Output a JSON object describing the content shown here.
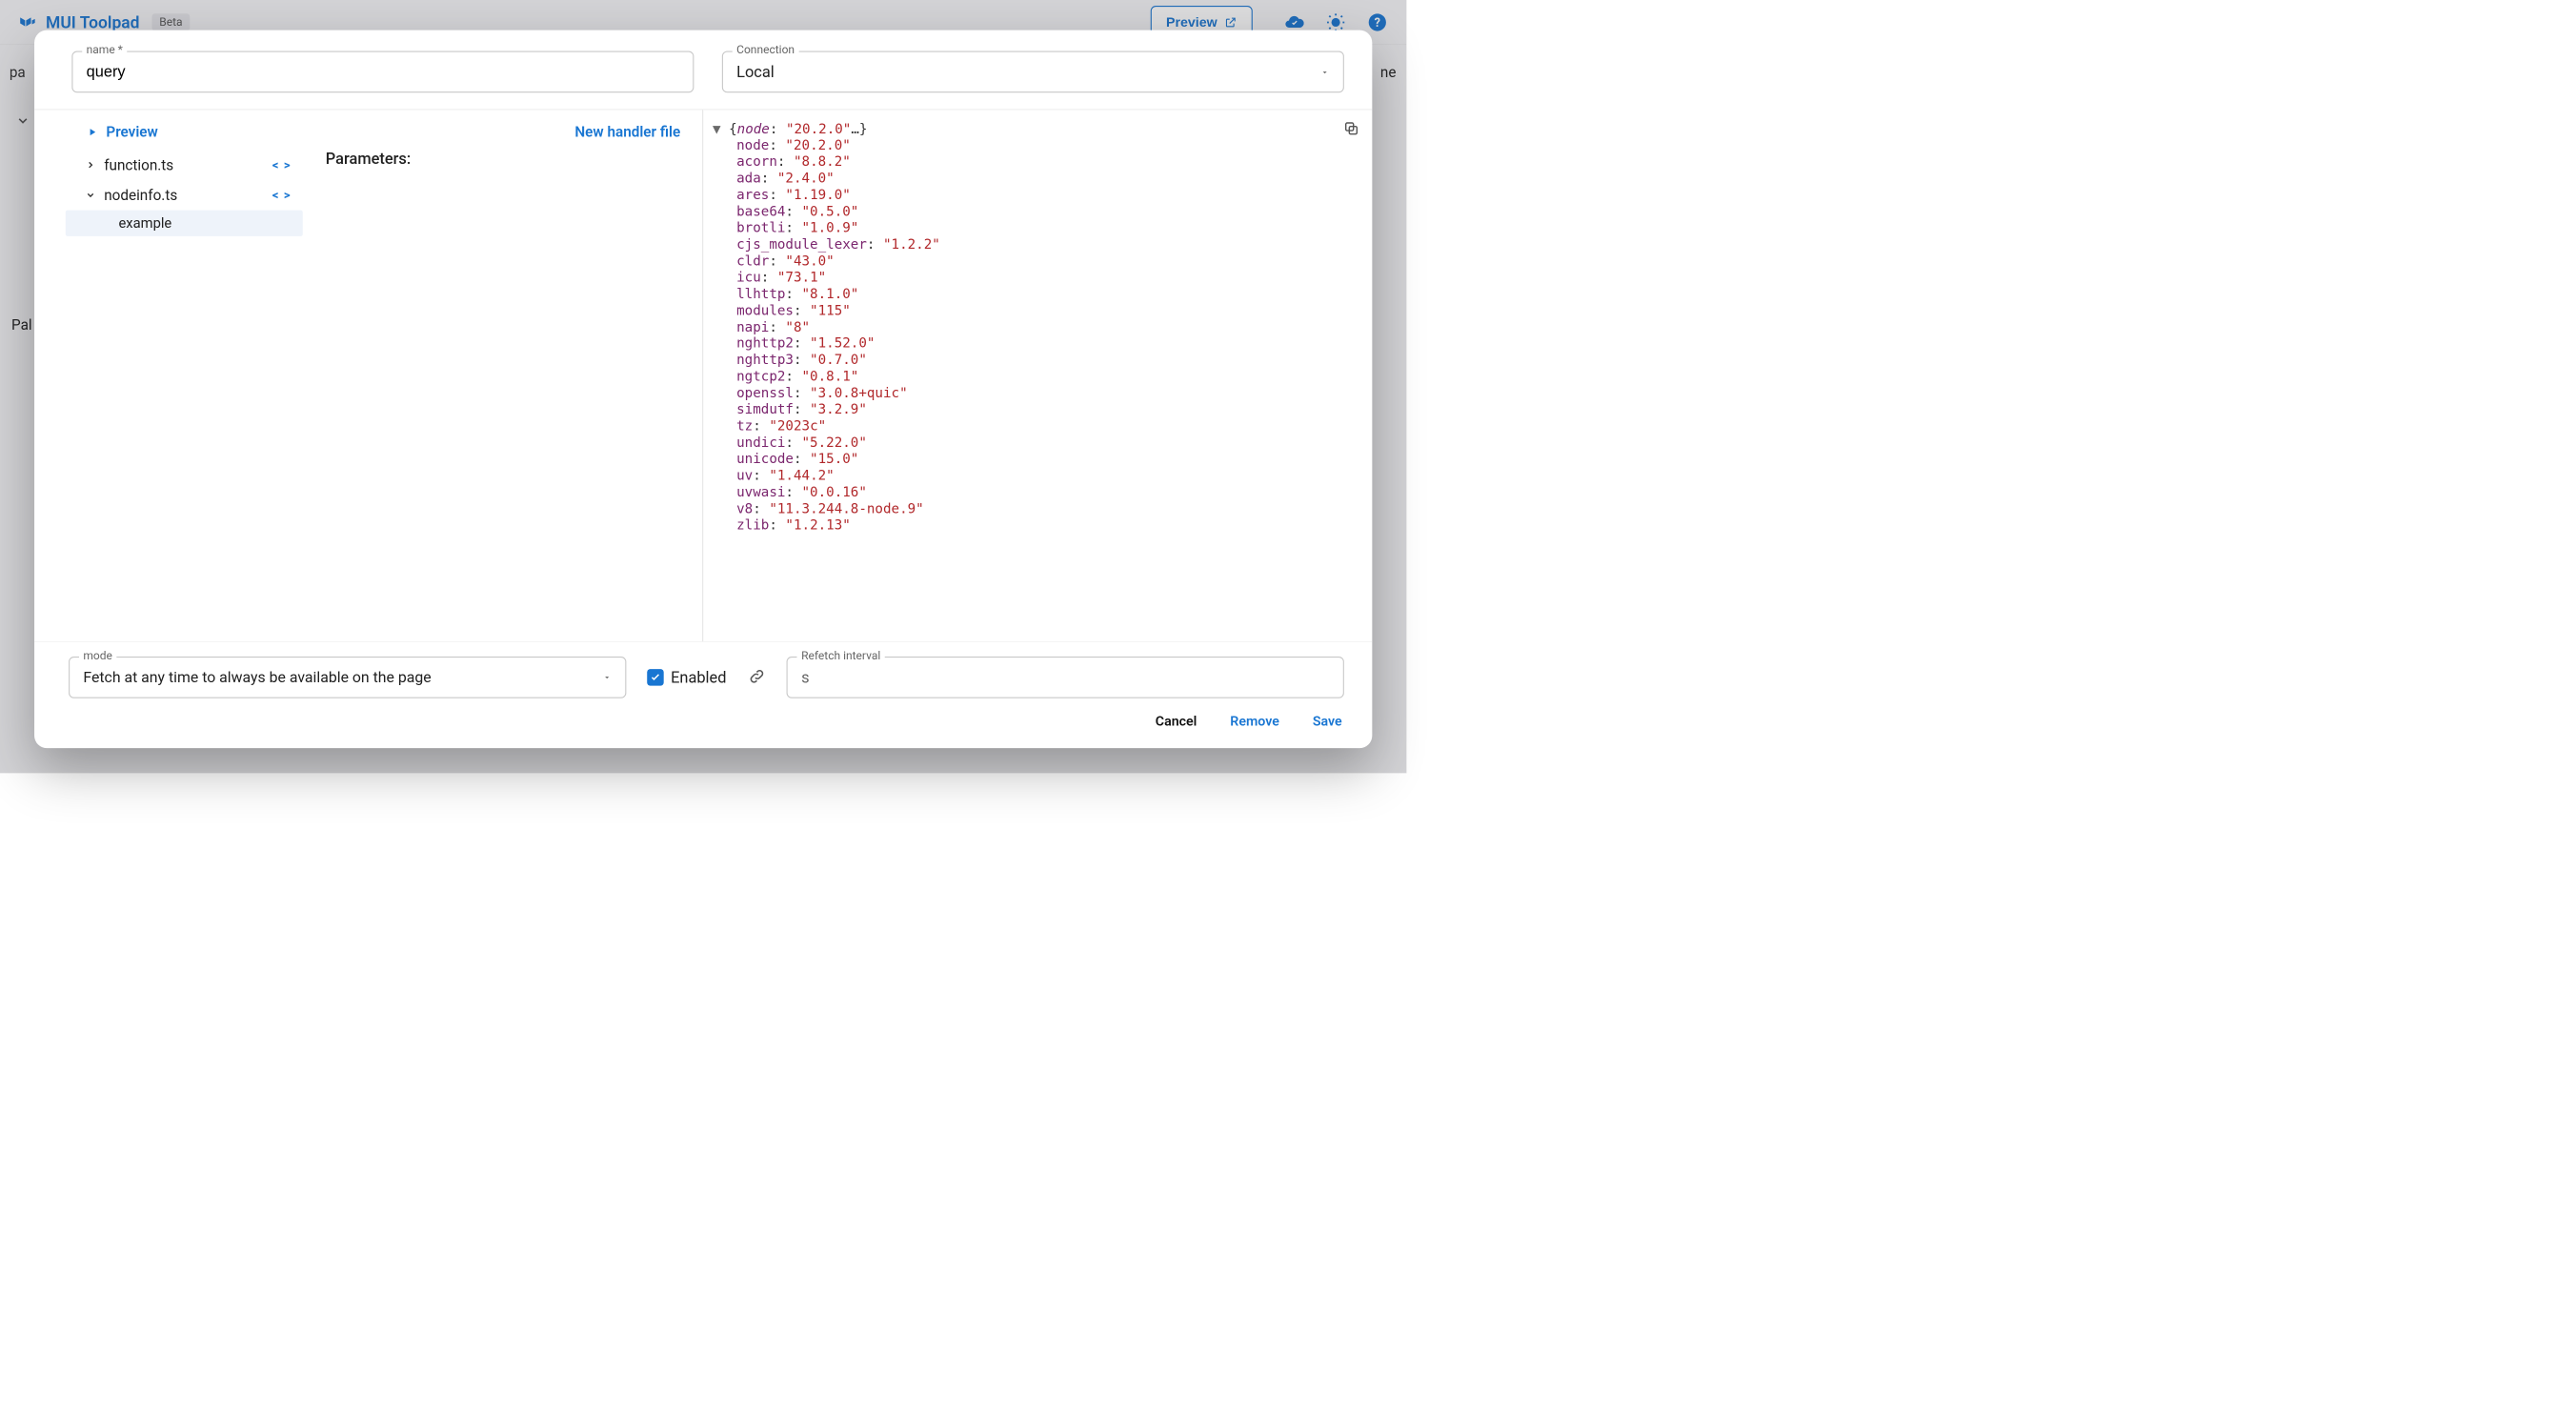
{
  "app": {
    "title": "MUI Toolpad",
    "beta_chip": "Beta",
    "preview_btn": "Preview"
  },
  "backdrop": {
    "left_partial_top": "pa",
    "left_partial_mid": "Pal",
    "right_partial": "ne"
  },
  "dialog": {
    "name_label": "name *",
    "name_value": "query",
    "connection_label": "Connection",
    "connection_value": "Local",
    "preview_run": "Preview",
    "new_handler": "New handler file",
    "parameters_label": "Parameters:",
    "tree": {
      "items": [
        {
          "name": "function.ts",
          "expanded": false
        },
        {
          "name": "nodeinfo.ts",
          "expanded": true,
          "children": [
            "example"
          ]
        }
      ]
    },
    "mode_label": "mode",
    "mode_value": "Fetch at any time to always be available on the page",
    "enabled_label": "Enabled",
    "enabled_checked": true,
    "refetch_label": "Refetch interval",
    "refetch_suffix": "s",
    "buttons": {
      "cancel": "Cancel",
      "remove": "Remove",
      "save": "Save"
    }
  },
  "result_json": {
    "summary_key": "node",
    "summary_value": "20.2.0",
    "entries": [
      {
        "k": "node",
        "v": "20.2.0"
      },
      {
        "k": "acorn",
        "v": "8.8.2"
      },
      {
        "k": "ada",
        "v": "2.4.0"
      },
      {
        "k": "ares",
        "v": "1.19.0"
      },
      {
        "k": "base64",
        "v": "0.5.0"
      },
      {
        "k": "brotli",
        "v": "1.0.9"
      },
      {
        "k": "cjs_module_lexer",
        "v": "1.2.2"
      },
      {
        "k": "cldr",
        "v": "43.0"
      },
      {
        "k": "icu",
        "v": "73.1"
      },
      {
        "k": "llhttp",
        "v": "8.1.0"
      },
      {
        "k": "modules",
        "v": "115"
      },
      {
        "k": "napi",
        "v": "8"
      },
      {
        "k": "nghttp2",
        "v": "1.52.0"
      },
      {
        "k": "nghttp3",
        "v": "0.7.0"
      },
      {
        "k": "ngtcp2",
        "v": "0.8.1"
      },
      {
        "k": "openssl",
        "v": "3.0.8+quic"
      },
      {
        "k": "simdutf",
        "v": "3.2.9"
      },
      {
        "k": "tz",
        "v": "2023c"
      },
      {
        "k": "undici",
        "v": "5.22.0"
      },
      {
        "k": "unicode",
        "v": "15.0"
      },
      {
        "k": "uv",
        "v": "1.44.2"
      },
      {
        "k": "uvwasi",
        "v": "0.0.16"
      },
      {
        "k": "v8",
        "v": "11.3.244.8-node.9"
      },
      {
        "k": "zlib",
        "v": "1.2.13"
      }
    ]
  }
}
